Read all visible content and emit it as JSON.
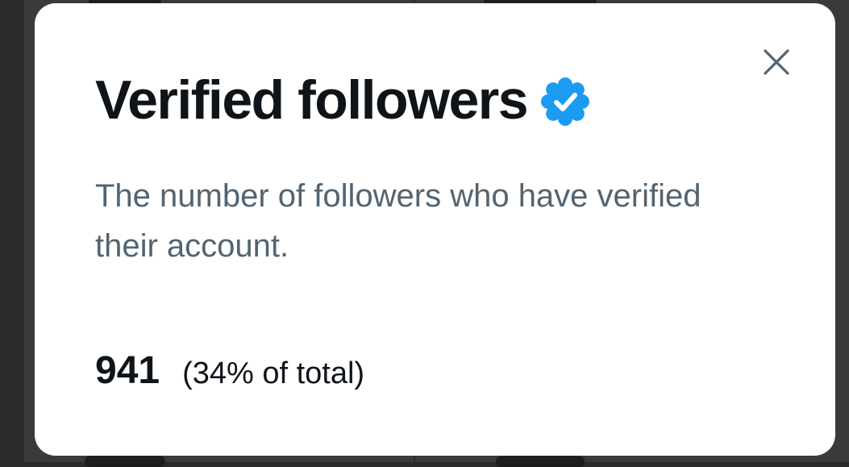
{
  "modal": {
    "title": "Verified followers",
    "description": "The number of followers who have verified their account.",
    "stat_value": "941",
    "stat_percent": "(34% of total)",
    "close_icon": "close-icon",
    "badge_icon": "verified-badge-icon"
  },
  "colors": {
    "badge_blue": "#1d9bf0",
    "title_text": "#0f1419",
    "secondary_text": "#536471",
    "modal_bg": "#ffffff",
    "backdrop": "#2b2b2b"
  }
}
